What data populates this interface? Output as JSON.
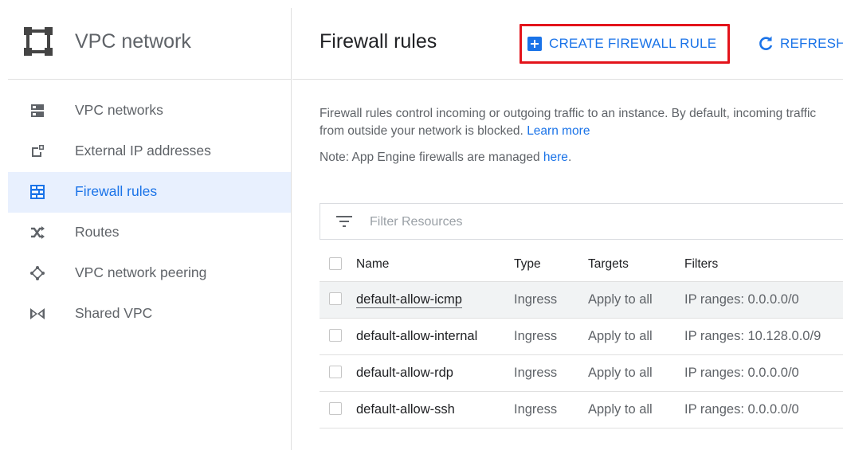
{
  "sidebar": {
    "title": "VPC network",
    "items": [
      {
        "label": "VPC networks",
        "icon": "vpc-networks-icon"
      },
      {
        "label": "External IP addresses",
        "icon": "external-ip-icon"
      },
      {
        "label": "Firewall rules",
        "icon": "firewall-icon",
        "active": true
      },
      {
        "label": "Routes",
        "icon": "routes-icon"
      },
      {
        "label": "VPC network peering",
        "icon": "peering-icon"
      },
      {
        "label": "Shared VPC",
        "icon": "shared-vpc-icon"
      }
    ]
  },
  "header": {
    "title": "Firewall rules",
    "create_label": "CREATE FIREWALL RULE",
    "refresh_label": "REFRESH"
  },
  "description": {
    "text": "Firewall rules control incoming or outgoing traffic to an instance. By default, incoming traffic from outside your network is blocked.",
    "learn_more": "Learn more",
    "note_prefix": "Note: App Engine firewalls are managed",
    "note_link": "here",
    "note_suffix": "."
  },
  "filter": {
    "placeholder": "Filter Resources"
  },
  "table": {
    "columns": [
      "Name",
      "Type",
      "Targets",
      "Filters"
    ],
    "rows": [
      {
        "name": "default-allow-icmp",
        "type": "Ingress",
        "targets": "Apply to all",
        "filters": "IP ranges: 0.0.0.0/0"
      },
      {
        "name": "default-allow-internal",
        "type": "Ingress",
        "targets": "Apply to all",
        "filters": "IP ranges: 10.128.0.0/9"
      },
      {
        "name": "default-allow-rdp",
        "type": "Ingress",
        "targets": "Apply to all",
        "filters": "IP ranges: 0.0.0.0/0"
      },
      {
        "name": "default-allow-ssh",
        "type": "Ingress",
        "targets": "Apply to all",
        "filters": "IP ranges: 0.0.0.0/0"
      }
    ]
  },
  "colors": {
    "accent": "#1a73e8",
    "highlight": "#e3141b",
    "active_bg": "#e8f0fe"
  }
}
